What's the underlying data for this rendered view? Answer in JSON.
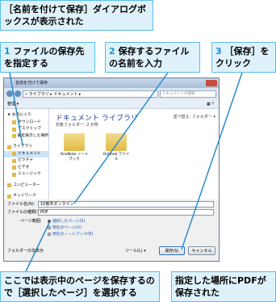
{
  "callouts": {
    "title": "［名前を付けて保存］ダイアログボックスが表示された",
    "step1_num": "1",
    "step1_text": "ファイルの保存先を指定する",
    "step2_num": "2",
    "step2_text": "保存するファイルの名前を入力",
    "step3_num": "3",
    "step3_text": "［保存］をクリック",
    "bottom_left": "ここでは表示中のページを保存するので［選択したページ］を選択する",
    "bottom_right": "指定した場所にPDFが保存された"
  },
  "dialog": {
    "title": "名前を付けて保存",
    "path": "« ライブラリ ▸ ドキュメント ▸",
    "search_placeholder": "ドキュメントの検索",
    "toolbar_left": "整理 ▾",
    "nav_items": [
      "★ お気に入り",
      "ダウンロード",
      "デスクトップ",
      "最近表示した場所",
      "ライブラリ",
      "ドキュメント",
      "ピクチャ",
      "ビデオ",
      "ミュージック",
      "コンピューター",
      "ネットワーク"
    ],
    "library_title": "ドキュメント ライブラリ",
    "library_sub": "対象フォルダー: 2 か所",
    "arrange_label": "並べ替え: フォルダー ▾",
    "folders": [
      "OneNote ノートブック",
      "Outlook ファイル"
    ],
    "filename_label": "ファイル名(N):",
    "filename_value": "10番市オンライン",
    "filetype_label": "ファイルの種類(T):",
    "filetype_value": "PDF",
    "range_label": "ページ範囲:",
    "range_options": [
      "選択したページ(S)",
      "現在のページ(U)",
      "現在のノートブック(B)"
    ],
    "hide_folders": "フォルダーの非表示",
    "tools": "ツール(L) ▾",
    "save_button": "保存(S)",
    "cancel_button": "キャンセル"
  }
}
